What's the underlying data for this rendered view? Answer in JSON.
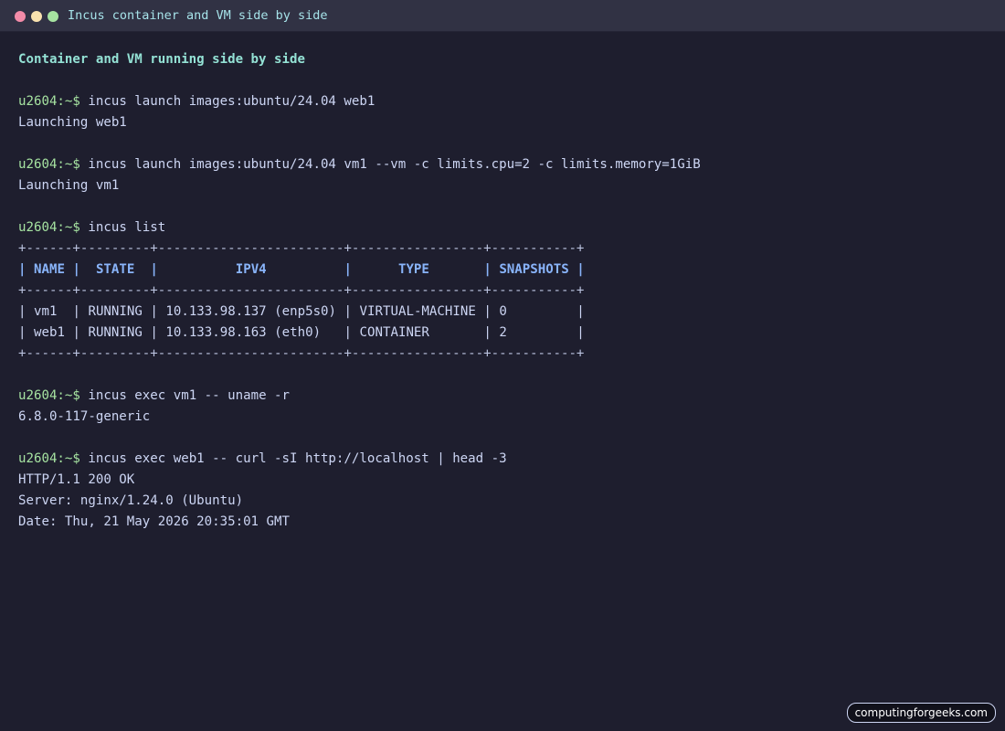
{
  "window": {
    "title": "Incus container and VM side by side",
    "controls": {
      "close_color": "#f38ba8",
      "minimize_color": "#f9e2af",
      "zoom_color": "#a6e3a1"
    }
  },
  "terminal": {
    "heading": "Container and VM running side by side",
    "prompt": "u2604:~$",
    "blocks": [
      {
        "command": "incus launch images:ubuntu/24.04 web1",
        "output": [
          "Launching web1"
        ]
      },
      {
        "command": "incus launch images:ubuntu/24.04 vm1 --vm -c limits.cpu=2 -c limits.memory=1GiB",
        "output": [
          "Launching vm1"
        ]
      },
      {
        "command": "incus list"
      },
      {
        "command": "incus exec vm1 -- uname -r",
        "output": [
          "6.8.0-117-generic"
        ]
      },
      {
        "command": "incus exec web1 -- curl -sI http://localhost | head -3",
        "output": [
          "HTTP/1.1 200 OK",
          "Server: nginx/1.24.0 (Ubuntu)",
          "Date: Thu, 21 May 2026 20:35:01 GMT"
        ]
      }
    ],
    "table": {
      "border": "+------+---------+------------------------+-----------------+-----------+",
      "headers": [
        "NAME",
        "STATE",
        "IPV4",
        "TYPE",
        "SNAPSHOTS"
      ],
      "rows": [
        [
          "vm1",
          "RUNNING",
          "10.133.98.137 (enp5s0)",
          "VIRTUAL-MACHINE",
          "0"
        ],
        [
          "web1",
          "RUNNING",
          "10.133.98.163 (eth0)",
          "CONTAINER",
          "2"
        ]
      ]
    }
  },
  "watermark": "computingforgeeks.com"
}
